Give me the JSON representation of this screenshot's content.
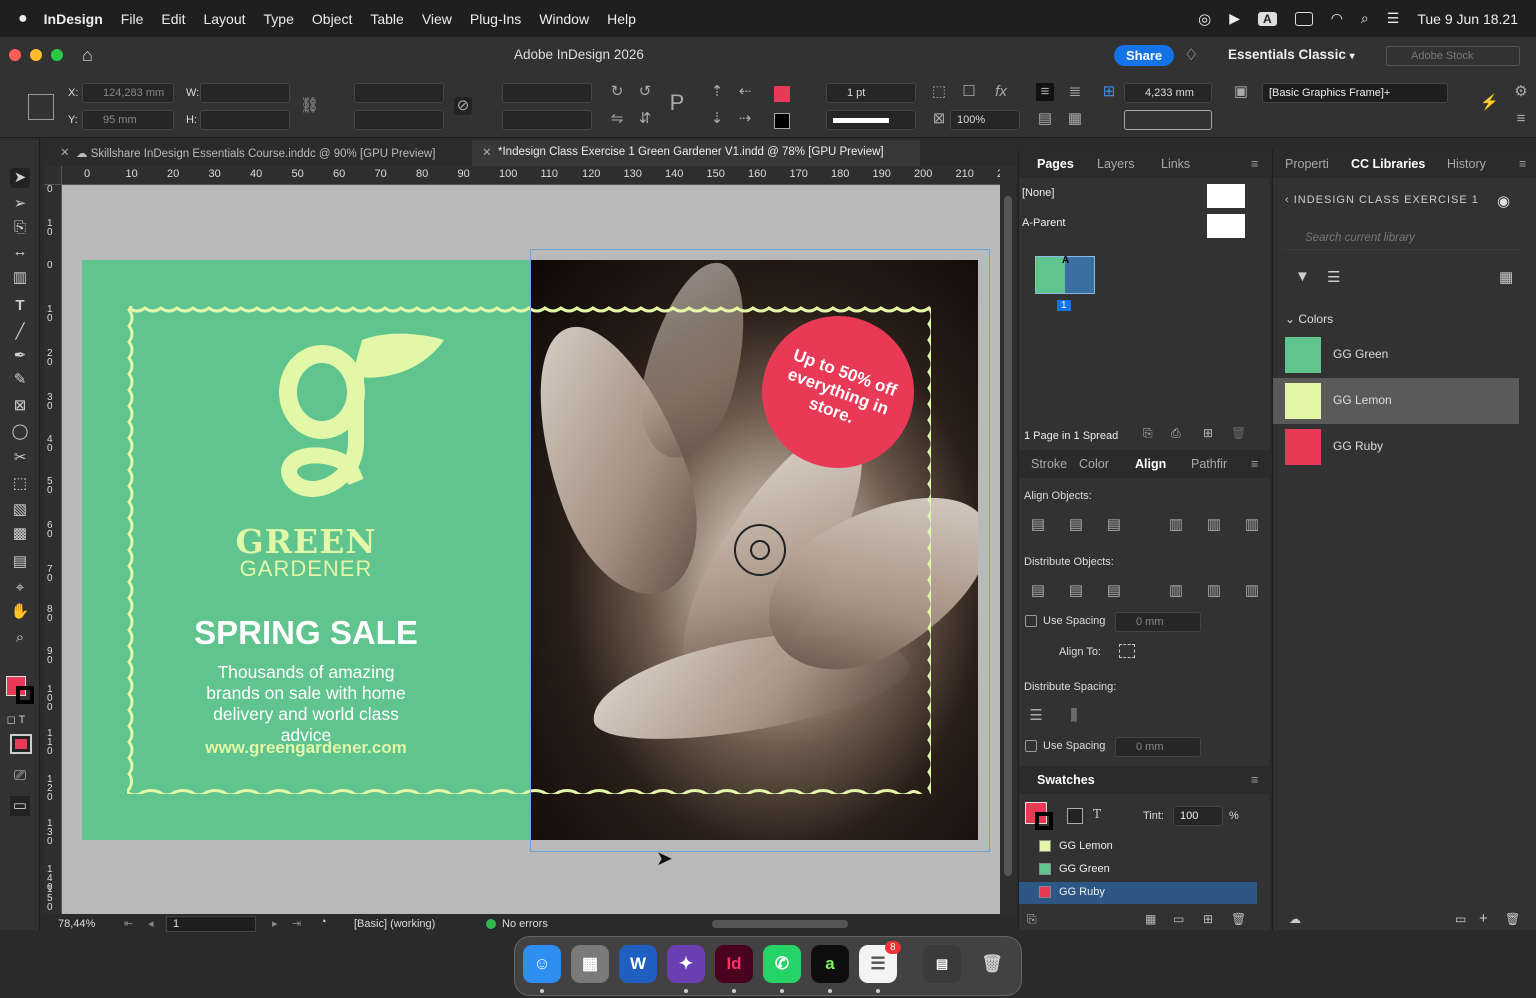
{
  "menubar": {
    "app": "InDesign",
    "items": [
      "File",
      "Edit",
      "Layout",
      "Type",
      "Object",
      "Table",
      "View",
      "Plug-Ins",
      "Window",
      "Help"
    ],
    "clock": "Tue 9 Jun  18.21",
    "text_input_indicator": "A"
  },
  "titlebar": {
    "title": "Adobe InDesign 2026",
    "share": "Share",
    "workspace": "Essentials Classic",
    "stock_placeholder": "Adobe Stock"
  },
  "control": {
    "x_label": "X:",
    "x_value": "124,283 mm",
    "y_label": "Y:",
    "y_value": "95 mm",
    "w_label": "W:",
    "h_label": "H:",
    "stroke_weight": "1 pt",
    "percent": "100%",
    "offset": "4,233 mm",
    "frame_style": "[Basic Graphics Frame]+"
  },
  "tabs": [
    {
      "label": "Skillshare InDesign Essentials Course.inddc @ 90% [GPU Preview]",
      "active": false
    },
    {
      "label": "*Indesign Class Exercise 1 Green Gardener V1.indd @ 78% [GPU Preview]",
      "active": true
    }
  ],
  "ruler": {
    "h_ticks": [
      "0",
      "10",
      "20",
      "30",
      "40",
      "50",
      "60",
      "70",
      "80",
      "90",
      "100",
      "110",
      "120",
      "130",
      "140",
      "150",
      "160",
      "170",
      "180",
      "190",
      "200",
      "210",
      "2"
    ],
    "v_ticks": [
      "0",
      "1 0",
      "0",
      "1 0",
      "2 0",
      "3 0",
      "4 0",
      "5 0",
      "6 0",
      "7 0",
      "8 0",
      "9 0",
      "1 0 0",
      "1 1 0",
      "1 2 0",
      "1 3 0",
      "1 4 0",
      "1 5 0"
    ]
  },
  "artwork": {
    "brand_line1": "GREEN",
    "brand_line2": "GARDENER",
    "headline": "SPRING SALE",
    "body": "Thousands of amazing brands on sale with home delivery and world class advice",
    "url": "www.greengardener.com",
    "badge": "Up to 50% off everything in store.",
    "colors": {
      "green": "#5fc48e",
      "lemon": "#e2f7a8",
      "ruby": "#e83a57"
    }
  },
  "status": {
    "zoom": "78,44%",
    "page": "1",
    "preflight_profile": "[Basic] (working)",
    "errors": "No errors"
  },
  "pages_panel": {
    "tabs": [
      "Pages",
      "Layers",
      "Links"
    ],
    "masters": [
      "[None]",
      "A-Parent"
    ],
    "page_number": "1",
    "page_letter": "A",
    "summary": "1 Page in 1 Spread"
  },
  "align_panel": {
    "tabs": [
      "Stroke",
      "Color",
      "Align",
      "Pathfir"
    ],
    "align_objects": "Align Objects:",
    "distribute_objects": "Distribute Objects:",
    "use_spacing": "Use Spacing",
    "spacing_value": "0 mm",
    "align_to": "Align To:",
    "distribute_spacing": "Distribute Spacing:"
  },
  "swatches_panel": {
    "title": "Swatches",
    "tint_label": "Tint:",
    "tint_value": "100",
    "tint_unit": "%",
    "swatches": [
      {
        "name": "GG Lemon",
        "color": "#e2f7a8"
      },
      {
        "name": "GG Green",
        "color": "#5fc48e"
      },
      {
        "name": "GG Ruby",
        "color": "#e83a57"
      }
    ]
  },
  "libraries_panel": {
    "tabs": [
      "Properti",
      "CC Libraries",
      "History"
    ],
    "library_name": "INDESIGN CLASS EXERCISE 1",
    "search_placeholder": "Search current library",
    "section": "Colors",
    "colors": [
      {
        "name": "GG Green",
        "color": "#5fc48e"
      },
      {
        "name": "GG Lemon",
        "color": "#e2f7a8"
      },
      {
        "name": "GG Ruby",
        "color": "#e83a57"
      }
    ]
  },
  "dock": {
    "badge_count": "8"
  }
}
